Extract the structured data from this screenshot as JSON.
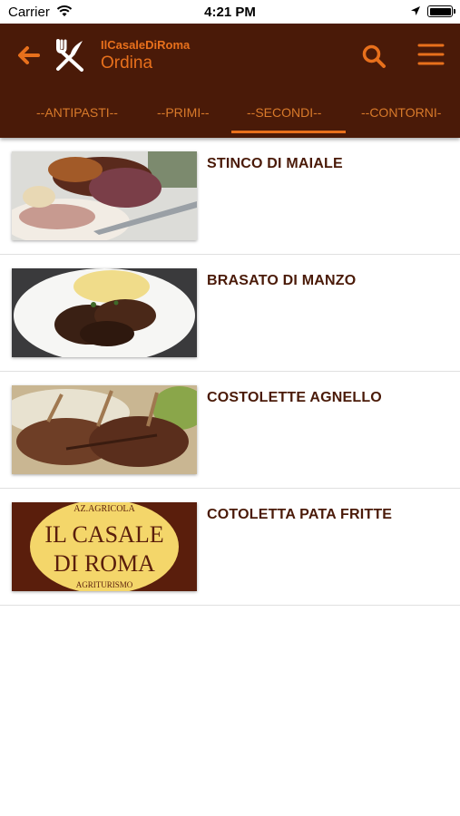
{
  "status_bar": {
    "carrier": "Carrier",
    "time": "4:21 PM"
  },
  "header": {
    "app_name": "IlCasaleDiRoma",
    "title": "Ordina",
    "accent_color": "#e8701c",
    "background_color": "#4a1a08",
    "back_icon": "arrow-left-icon",
    "logo_icon": "fork-knife-icon",
    "search_icon": "search-icon",
    "menu_icon": "hamburger-menu-icon"
  },
  "tabs": [
    {
      "label": "--ANTIPASTI--"
    },
    {
      "label": "--PRIMI--"
    },
    {
      "label": "--SECONDI--",
      "selected": true
    },
    {
      "label": "--CONTORNI-"
    }
  ],
  "menu_items": [
    {
      "name": "STINCO DI MAIALE"
    },
    {
      "name": "BRASATO DI MANZO"
    },
    {
      "name": "COSTOLETTE AGNELLO"
    },
    {
      "name": "COTOLETTA PATA FRITTE"
    }
  ],
  "logo_card": {
    "line_top": "AZ.AGRICOLA",
    "line_1": "IL CASALE",
    "line_2": "DI ROMA",
    "line_bottom": "AGRITURISMO"
  }
}
